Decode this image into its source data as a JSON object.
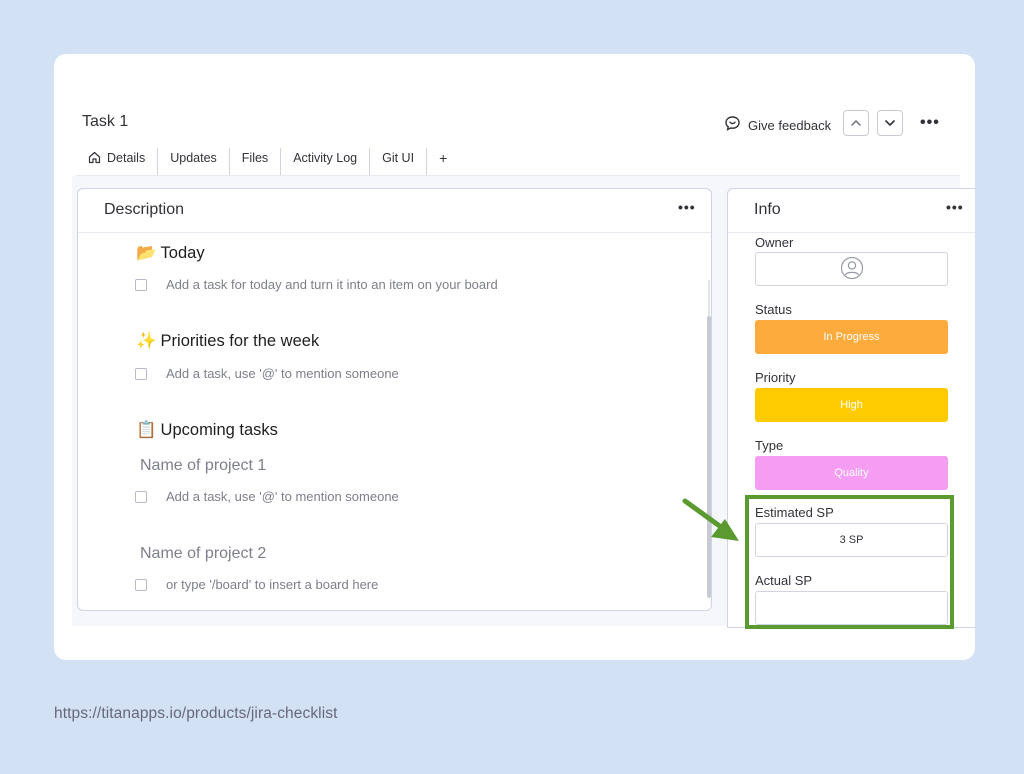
{
  "header": {
    "title": "Task 1",
    "feedback_label": "Give feedback"
  },
  "tabs": [
    {
      "label": "Details",
      "active": true,
      "icon": "home-icon"
    },
    {
      "label": "Updates"
    },
    {
      "label": "Files"
    },
    {
      "label": "Activity Log"
    },
    {
      "label": "Git UI"
    },
    {
      "label": "+"
    }
  ],
  "description": {
    "title": "Description",
    "sections": [
      {
        "icon": "📂",
        "title": "Today",
        "tasks": [
          "Add a task for today and turn it into an item on your board"
        ]
      },
      {
        "icon": "✨",
        "title": "Priorities for the week",
        "tasks": [
          "Add a task, use '@' to mention someone"
        ]
      },
      {
        "icon": "📋",
        "title": "Upcoming tasks"
      }
    ],
    "projects": [
      {
        "name": "Name of project 1",
        "task": "Add a task, use '@' to mention someone"
      },
      {
        "name": "Name of project 2",
        "task": "or type '/board' to insert a board here"
      }
    ]
  },
  "info": {
    "title": "Info",
    "owner_label": "Owner",
    "status_label": "Status",
    "status_value": "In Progress",
    "status_color": "#fdab3d",
    "priority_label": "Priority",
    "priority_value": "High",
    "priority_color": "#ffcb00",
    "type_label": "Type",
    "type_value": "Quality",
    "type_color": "#f59df3",
    "estimated_label": "Estimated SP",
    "estimated_value": "3 SP",
    "actual_label": "Actual SP",
    "actual_value": ""
  },
  "annotation": {
    "highlight_color": "#5a9a2f"
  },
  "footer": {
    "url": "https://titanapps.io/products/jira-checklist"
  }
}
